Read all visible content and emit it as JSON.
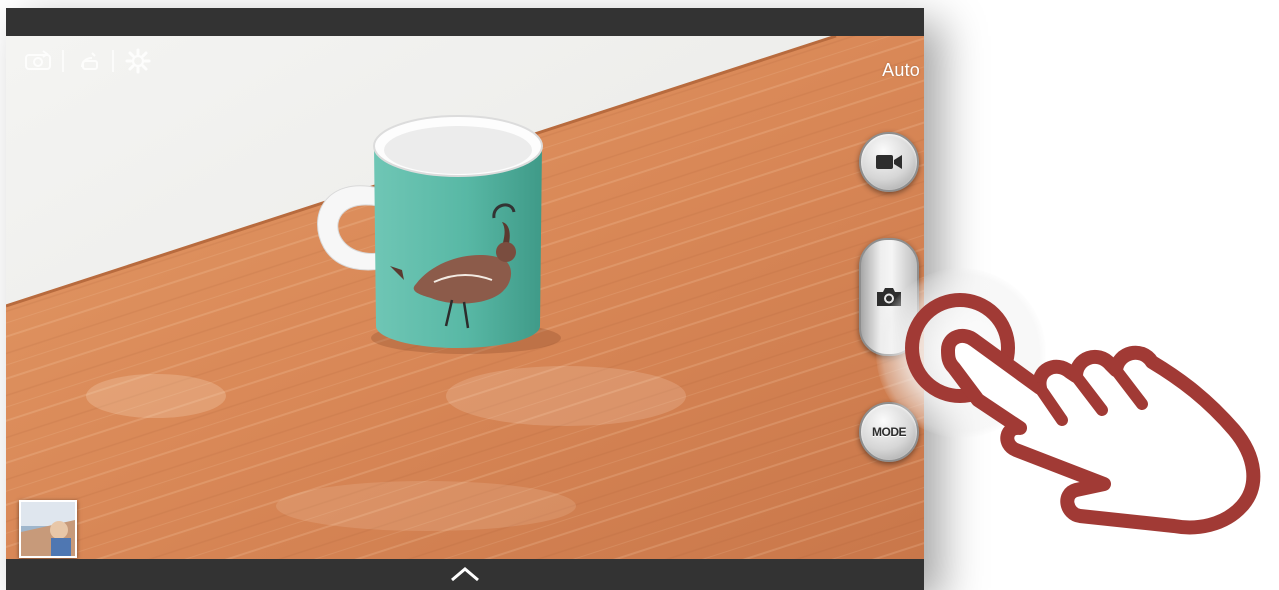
{
  "camera": {
    "mode_label": "Auto",
    "mode_button_label": "MODE"
  },
  "colors": {
    "bars": "#333333",
    "hand_outline": "#a13a35",
    "mug_teal": "#56b8a5"
  },
  "icons": {
    "settings": [
      "self-portrait-icon",
      "flash-icon",
      "settings-gear-icon"
    ],
    "right_controls": [
      "video-camera-icon",
      "camera-icon",
      "mode-icon"
    ],
    "bottom": "chevron-up-icon",
    "overlay": "tapping-hand-icon"
  }
}
